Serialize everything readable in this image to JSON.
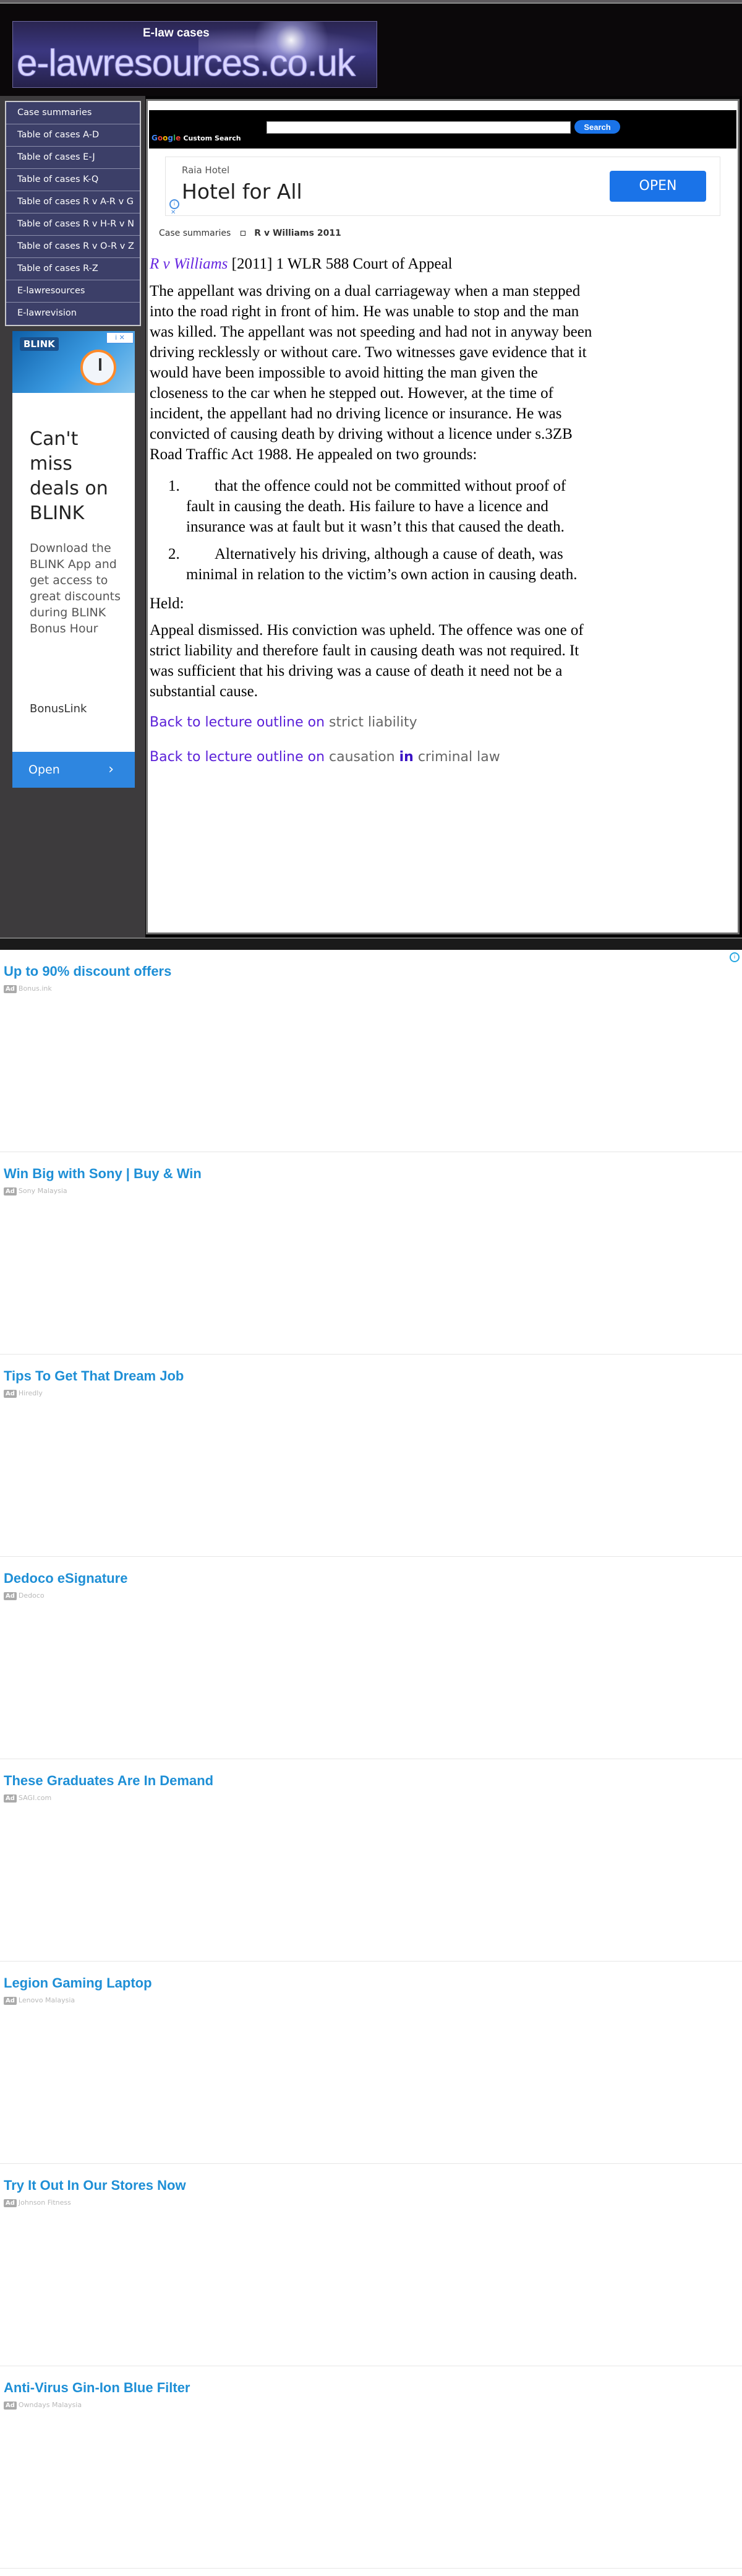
{
  "header": {
    "logo_sub": "E-law cases",
    "logo_main": "e-lawresources.co.uk"
  },
  "nav": {
    "items": [
      "Case summaries",
      "Table of cases A-D",
      "Table of cases E-J",
      "Table of cases K-Q",
      "Table of cases R v A-R v G",
      "Table of cases R v H-R v N",
      "Table of cases R v O-R v Z",
      "Table of cases R-Z",
      "E-lawresources",
      "E-lawrevision"
    ]
  },
  "left_ad": {
    "banner_brand": "BLINK",
    "headline": "Can't miss deals on BLINK",
    "body": "Download the BLINK App and get access to great discounts during BLINK Bonus Hour",
    "brand": "BonusLink",
    "cta": "Open",
    "cta_icon": "chevron-right-icon"
  },
  "search": {
    "placeholder": "",
    "button_label": "Search",
    "powered_google": [
      "G",
      "o",
      "o",
      "g",
      "l",
      "e"
    ],
    "custom_search_label": "Custom Search"
  },
  "hotel_ad": {
    "advertiser": "Raia Hotel",
    "headline": "Hotel for All",
    "cta": "OPEN",
    "adchoices_icon": "info-icon"
  },
  "breadcrumb": {
    "parent": "Case summaries",
    "current": "R v Williams 2011"
  },
  "article": {
    "case_name": "R v Williams",
    "citation": " [2011] 1 WLR 588 Court of Appeal",
    "facts": "The appellant was driving on a dual carriageway when a man stepped into the road right in front of him. He was unable to stop and the man was killed. The appellant was not speeding and had not in anyway been driving recklessly or without care. Two witnesses gave evidence that it would have been impossible to avoid hitting the man given the closeness to the car when he stepped out. However, at the time of incident, the appellant had no driving licence or insurance. He was convicted of causing death by driving without a licence under s.3ZB Road Traffic Act 1988. He appealed on two grounds:",
    "grounds": [
      {
        "num": "1.",
        "text": "that the offence could not be committed without proof of fault in causing the death. His failure to have a licence and insurance was at fault but it wasn’t this that caused the death."
      },
      {
        "num": "2.",
        "text": "Alternatively his driving, although a cause of death, was minimal in relation to the victim’s own action in causing death."
      }
    ],
    "held_label": "Held:",
    "held": "Appeal dismissed. His conviction was upheld. The offence was one of strict liability and therefore fault in causing death was not required. It was sufficient that his driving was a cause of death it need not be a substantial cause.",
    "back_links": [
      {
        "prefix": "Back to lecture outline on ",
        "topic": "strict liability",
        "joiner": "",
        "tail": ""
      },
      {
        "prefix": "Back to lecture outline on ",
        "topic": "causation ",
        "joiner": "in",
        "tail": " criminal law"
      }
    ]
  },
  "feed": {
    "adinfo_icon": "info-icon",
    "ad_tag": "Ad",
    "items": [
      {
        "title": "Up to 90% discount offers",
        "source": "Bonus.ink"
      },
      {
        "title": "Win Big with Sony | Buy & Win",
        "source": "Sony Malaysia"
      },
      {
        "title": "Tips To Get That Dream Job",
        "source": "Hiredly"
      },
      {
        "title": "Dedoco eSignature",
        "source": "Dedoco"
      },
      {
        "title": "These Graduates Are In Demand",
        "source": "SAGI.com"
      },
      {
        "title": "Legion Gaming Laptop",
        "source": "Lenovo Malaysia"
      },
      {
        "title": "Try It Out In Our Stores Now",
        "source": "Johnson Fitness"
      },
      {
        "title": "Anti-Virus Gin-Ion Blue Filter",
        "source": "Owndays Malaysia"
      }
    ]
  }
}
